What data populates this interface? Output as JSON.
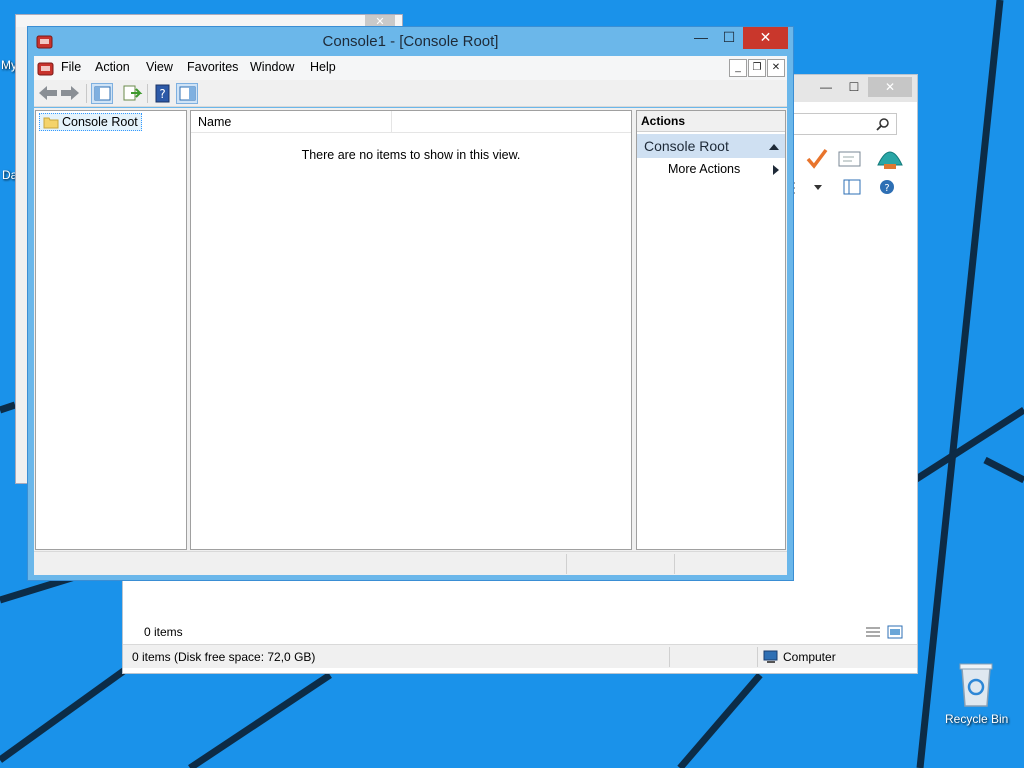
{
  "desktop": {
    "recycle_bin_label": "Recycle Bin",
    "partial_label_1": "My",
    "partial_label_2": "Da"
  },
  "back_window": {
    "items_count": "0 items",
    "status_text": "0 items (Disk free space: 72,0 GB)",
    "status_location": "Computer"
  },
  "mmc": {
    "title": "Console1 - [Console Root]",
    "menu": [
      "File",
      "Action",
      "View",
      "Favorites",
      "Window",
      "Help"
    ],
    "tree": {
      "root_label": "Console Root"
    },
    "list": {
      "column_name": "Name",
      "empty_text": "There are no items to show in this view."
    },
    "actions": {
      "header": "Actions",
      "group": "Console Root",
      "more": "More Actions"
    }
  },
  "colors": {
    "desktop": "#1a92ea",
    "window_frame": "#6bb7ea",
    "close_button": "#c9372c"
  }
}
